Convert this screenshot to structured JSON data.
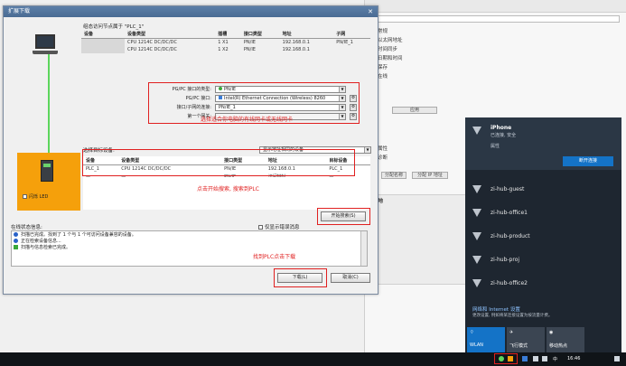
{
  "dialog": {
    "title": "扩展下载",
    "close_icon": "close-icon",
    "compat_title": "组态访问节点属于 \"PLC_1\"",
    "compat_headers": [
      "设备",
      "设备类型",
      "插槽",
      "接口类型",
      "地址",
      "子网"
    ],
    "compat_rows": [
      [
        "",
        "CPU 1214C DC/DC/DC",
        "1 X1",
        "PN/IE",
        "192.168.0.1",
        "PN/IE_1"
      ],
      [
        "",
        "CPU 1214C DC/DC/DC",
        "1 X2",
        "PN/IE",
        "192.168.0.1",
        ""
      ]
    ],
    "params": [
      {
        "label": "PG/PC 接口的类型:",
        "value": "PN/IE",
        "led": "#3aa83a"
      },
      {
        "label": "PG/PC 接口:",
        "value": "Intel(R) Ethernet Connection (Wireless) 8260",
        "led": "#3a7cd6"
      },
      {
        "label": "接口/子网的连接:",
        "value": "PN/IE_1",
        "led": ""
      },
      {
        "label": "第一个网关:",
        "value": "",
        "led": ""
      }
    ],
    "param_note": "选择适合你电脑的有线网卡或无线网卡",
    "scan_title": "选择目标设备:",
    "scan_filter": "显示地址相同的设备",
    "scan_headers": [
      "设备",
      "设备类型",
      "接口类型",
      "地址",
      "目标设备"
    ],
    "scan_rows": [
      [
        "PLC_1",
        "CPU 1214C DC/DC/DC",
        "PN/IE",
        "192.168.0.1",
        "PLC_1"
      ],
      [
        "—",
        "—",
        "PN/IE",
        "访问地址",
        "—"
      ]
    ],
    "scan_note": "点击开始搜索, 搜索到PLC",
    "flash_led": "闪烁 LED",
    "start_search_button": "开始搜索(S)",
    "status_title": "在线状态信息:",
    "status_only_errors": "仅显示错误消息",
    "status_rows": [
      {
        "text": "扫描已完成。找到了 1 个与 1 个可访问设备兼容的设备。",
        "color": "#2a62c8"
      },
      {
        "text": "正在检索设备信息...",
        "color": "#2a62c8"
      },
      {
        "text": "扫描与信息检索已完成。",
        "color": "#3aa83a"
      }
    ],
    "download_note": "找到PLC点击下载",
    "load_button": "下载(L)",
    "cancel_button": "取消(C)"
  },
  "bg_app": {
    "labels": [
      "常规",
      "以太网地址",
      "时间同步",
      "日期和时间",
      "保存",
      "在线",
      "属性",
      "诊断",
      "本地"
    ],
    "buttons": [
      "应用",
      "分配名称",
      "分配 IP 地址"
    ]
  },
  "wifi": {
    "connected": {
      "name": "iPhone",
      "status": "已连接, 安全",
      "props": "属性",
      "disconnect_button": "断开连接"
    },
    "networks": [
      "zi-hub-guest",
      "zi-hub-office1",
      "zi-hub-product",
      "zi-hub-proj",
      "zi-hub-office2"
    ],
    "settings_title": "网络和 Internet 设置",
    "settings_desc": "更改设置, 例如将某连接设置为按流量计费。",
    "tiles": [
      "WLAN",
      "飞行模式",
      "移动热点"
    ]
  },
  "taskbar": {
    "tray_time": "16:46",
    "tray_lang": "中"
  }
}
